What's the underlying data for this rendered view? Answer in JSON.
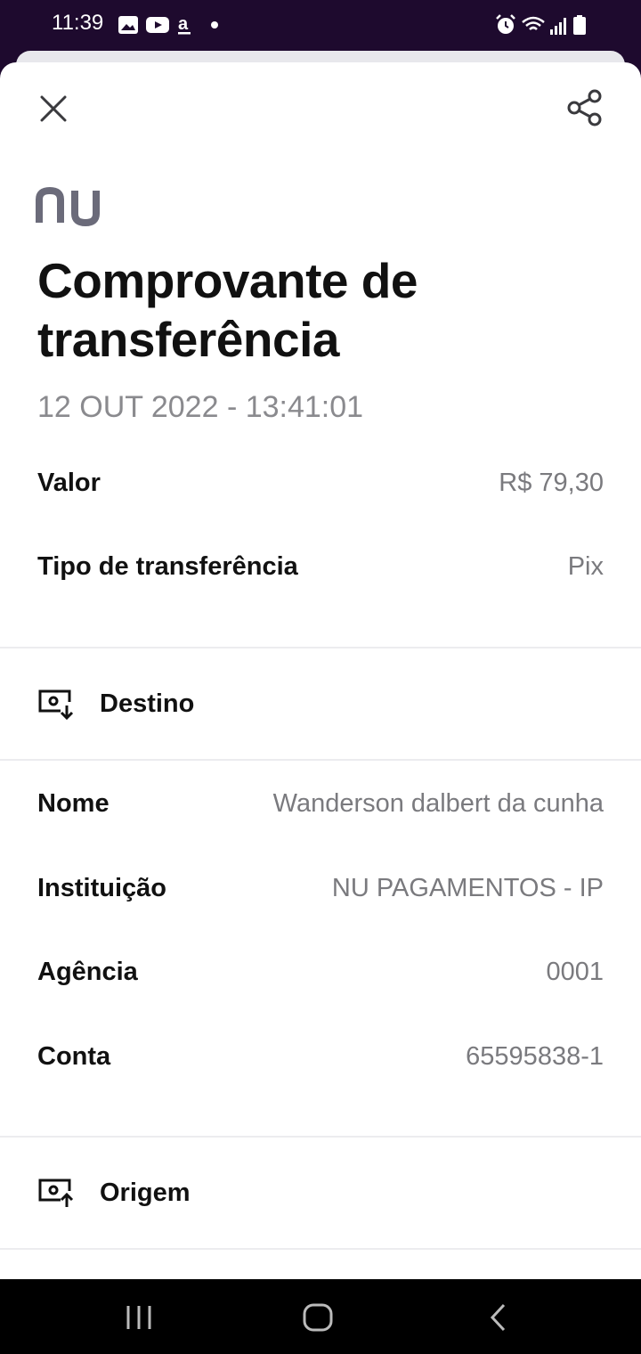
{
  "status_bar": {
    "time": "11:39",
    "left_icons": [
      "gallery-icon",
      "youtube-icon",
      "amazon-icon",
      "notification-dot-icon"
    ],
    "right_icons": [
      "alarm-icon",
      "wifi-icon",
      "signal-icon",
      "battery-icon"
    ]
  },
  "header": {
    "close_icon": "close-icon",
    "share_icon": "share-icon"
  },
  "brand": {
    "logo_text": "nu",
    "logo_color": "#6b6b7a"
  },
  "receipt": {
    "title": "Comprovante de transferência",
    "datetime": "12 OUT 2022 - 13:41:01"
  },
  "summary": [
    {
      "label": "Valor",
      "value": "R$ 79,30"
    },
    {
      "label": "Tipo de transferência",
      "value": "Pix"
    }
  ],
  "destination": {
    "title": "Destino",
    "icon": "destination-icon",
    "fields": [
      {
        "label": "Nome",
        "value": "Wanderson dalbert da cunha"
      },
      {
        "label": "Instituição",
        "value": "NU PAGAMENTOS - IP"
      },
      {
        "label": "Agência",
        "value": "0001"
      },
      {
        "label": "Conta",
        "value": "65595838-1"
      }
    ]
  },
  "origin": {
    "title": "Origem",
    "icon": "origin-icon"
  },
  "nav_bar": {
    "buttons": [
      "recent-apps-icon",
      "home-icon",
      "back-icon"
    ]
  },
  "colors": {
    "status_bar_bg": "#1e0a2e",
    "text_primary": "#111111",
    "text_secondary": "#7a7a7e",
    "divider": "#ececef"
  }
}
